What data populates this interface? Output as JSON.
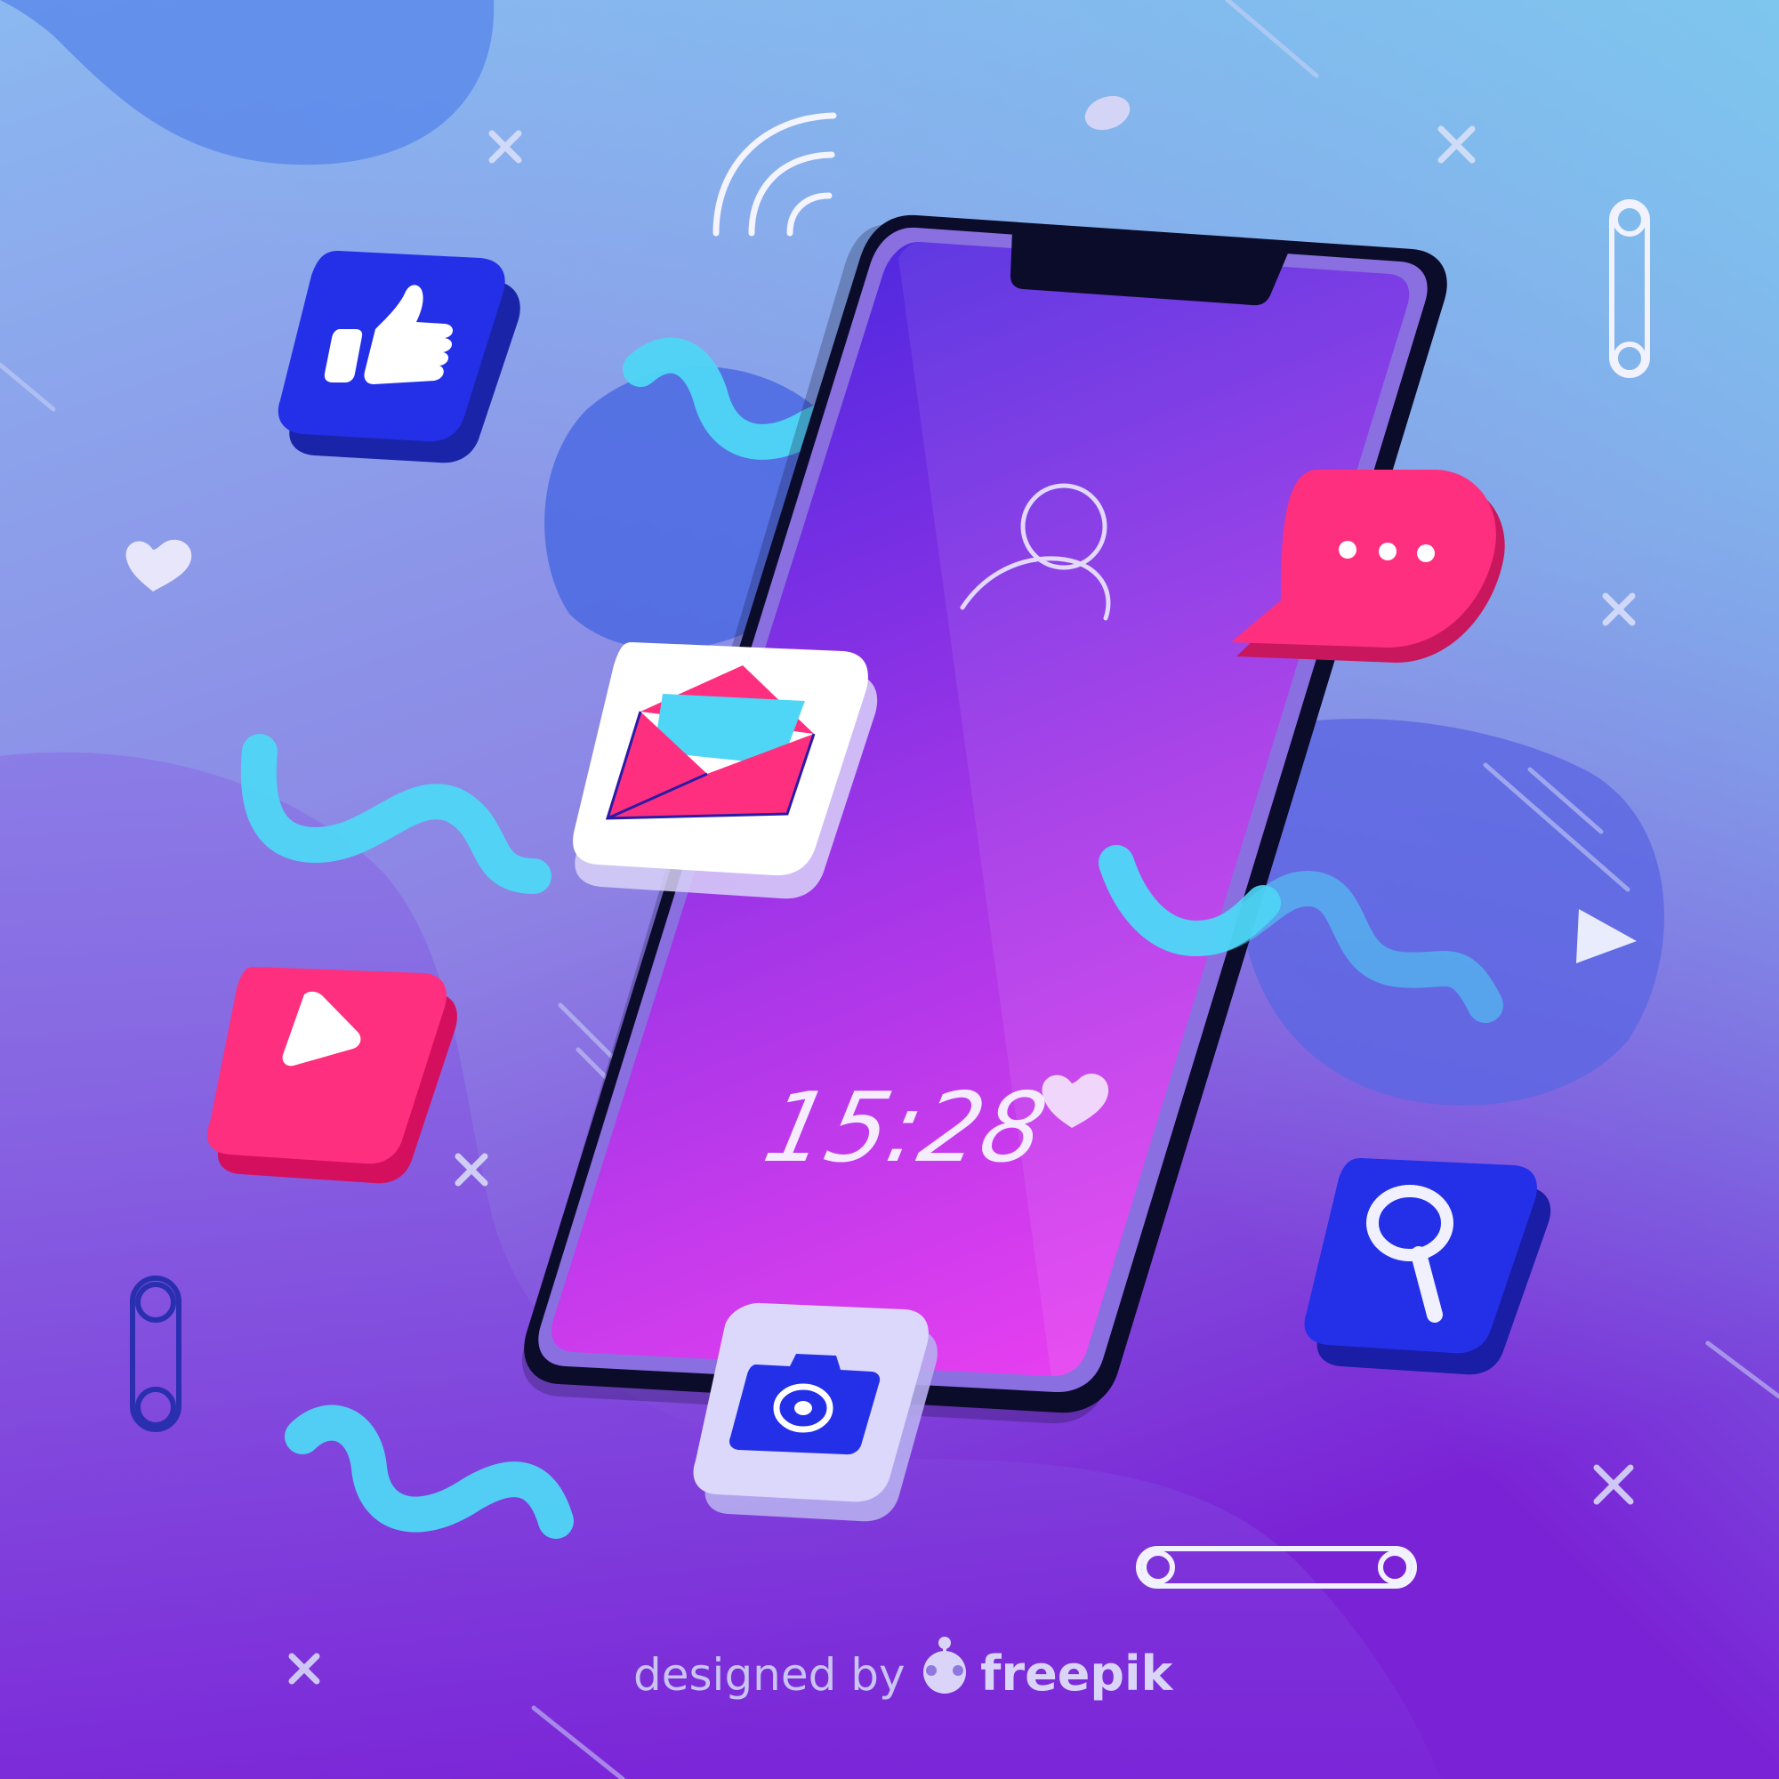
{
  "phone": {
    "clock": "15:28"
  },
  "credit": {
    "prefix": "designed by",
    "brand": "freepik"
  },
  "colors": {
    "background_top": "#7fc5ef",
    "background_mid": "#8b7fe6",
    "background_bottom": "#7a24d8",
    "screen_top": "#5b2be0",
    "screen_bottom": "#e43ff0",
    "phone_frame": "#0b0b2a",
    "pink": "#fe2f7e",
    "blue": "#2330e8",
    "cyan": "#4fd6f6",
    "lilac": "#d9d2f8"
  },
  "icons": [
    "thumbs-up-icon",
    "mail-icon",
    "play-icon",
    "chat-bubble-icon",
    "search-icon",
    "camera-icon",
    "wifi-icon",
    "user-icon",
    "heart-icon"
  ]
}
